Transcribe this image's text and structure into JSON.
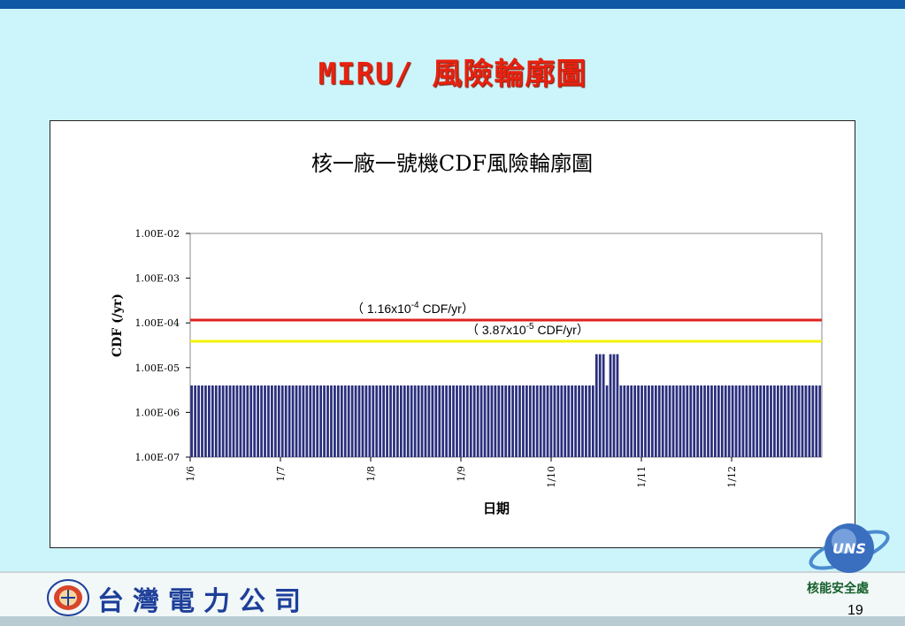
{
  "slide": {
    "title": "MIRU/ 風險輪廓圖",
    "company_name": "台灣電力公司",
    "uns_label": "核能安全處",
    "uns_logo_text": "UNS",
    "page_number": "19"
  },
  "colors": {
    "title_red": "#e8210f",
    "bar_fill": "#2a2f7d",
    "red_line": "#e02020",
    "yellow_line": "#f2f207"
  },
  "chart_data": {
    "type": "bar",
    "title": "核一廠一號機CDF風險輪廓圖",
    "xlabel": "日期",
    "ylabel": "CDF (/yr)",
    "yscale": "log",
    "ylim": [
      1e-07,
      0.01
    ],
    "ytick_labels": [
      "1.00E-07",
      "1.00E-06",
      "1.00E-05",
      "1.00E-04",
      "1.00E-03",
      "1.00E-02"
    ],
    "xtick_labels": [
      "1/6",
      "1/7",
      "1/8",
      "1/9",
      "1/10",
      "1/11",
      "1/12"
    ],
    "baseline_value": 4e-06,
    "bar_count": 181,
    "elevated_bars": [
      {
        "start": 116,
        "count": 3,
        "value": 2e-05
      },
      {
        "start": 120,
        "count": 3,
        "value": 2e-05
      }
    ],
    "reference_lines": [
      {
        "name": "mean-cdf",
        "value": 0.000116,
        "label_prefix": "（ 1.16x10",
        "label_exp": "-4",
        "label_suffix": " CDF/yr）",
        "color": "red"
      },
      {
        "name": "baseline-cdf",
        "value": 3.87e-05,
        "label_prefix": "（ 3.87x10",
        "label_exp": "-5",
        "label_suffix": " CDF/yr）",
        "color": "yellow"
      }
    ]
  }
}
